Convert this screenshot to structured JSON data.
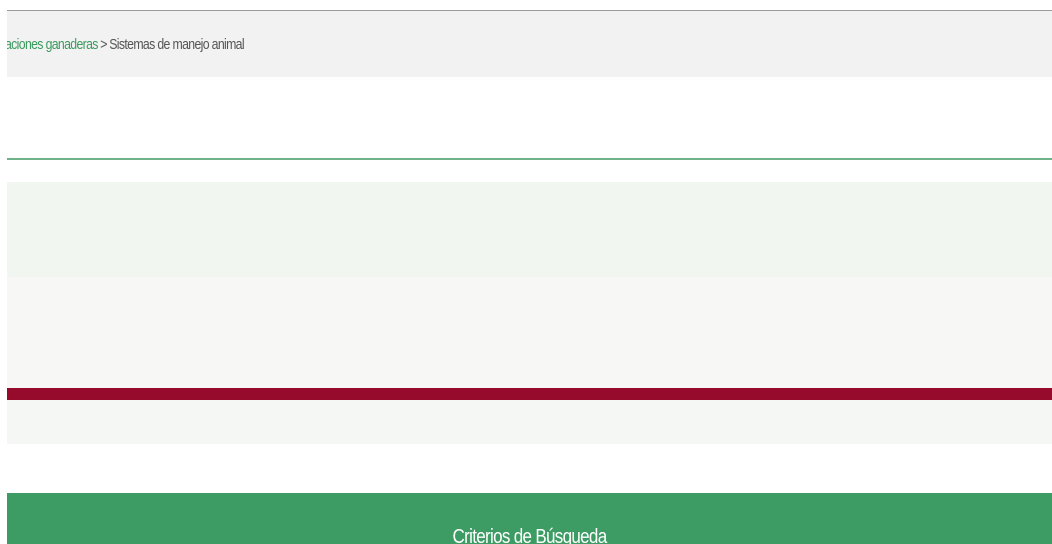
{
  "breadcrumb": {
    "items": [
      {
        "label": "aciones ganaderas",
        "link": true
      },
      {
        "label": "Sistemas de manejo animal",
        "link": false
      }
    ],
    "separator": ">"
  },
  "search_panel": {
    "title": "Criterios de Búsqueda"
  },
  "colors": {
    "brand_green": "#3d9c63",
    "link_green": "#3b9a5f",
    "accent_maroon": "#960a2c",
    "band_light_green": "#f1f6f1",
    "band_light_gray": "#f7f7f5"
  }
}
